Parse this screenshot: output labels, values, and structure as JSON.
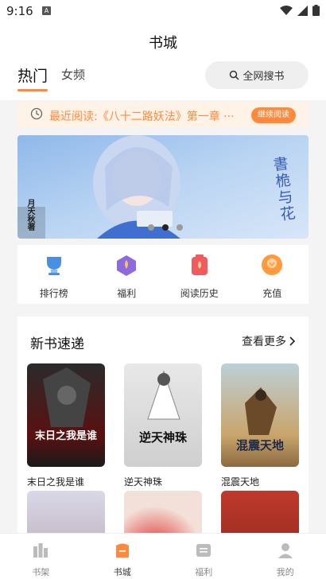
{
  "status_bar": {
    "time": "9:16",
    "notification_glyph": "A"
  },
  "header": {
    "title": "书城",
    "tabs": [
      {
        "label": "热门",
        "active": true
      },
      {
        "label": "女频",
        "active": false
      }
    ],
    "search_label": "全网搜书"
  },
  "recent_read": {
    "text": "最近阅读:《八十二路妖法》第一章 ···",
    "button_label": "继续阅读"
  },
  "banner": {
    "title_art": "書桅与花",
    "author_art": "月天秋著",
    "dot_count": 3,
    "active_dot": 1
  },
  "quick_menu": [
    {
      "label": "排行榜",
      "icon": "trophy-icon",
      "color": "#4a90e2"
    },
    {
      "label": "福利",
      "icon": "gift-icon",
      "color": "#8e6adf"
    },
    {
      "label": "阅读历史",
      "icon": "history-icon",
      "color": "#f05b5b"
    },
    {
      "label": "充值",
      "icon": "recharge-icon",
      "color": "#ff9a3d"
    }
  ],
  "new_books": {
    "title": "新书速递",
    "more_label": "查看更多",
    "books": [
      {
        "title": "末日之我是谁",
        "cover_text": "末日之我是谁"
      },
      {
        "title": "逆天神珠",
        "cover_text": "逆天神珠"
      },
      {
        "title": "混震天地",
        "cover_text": "混震天地"
      }
    ]
  },
  "tab_bar": [
    {
      "label": "书架",
      "icon": "bookshelf-icon",
      "active": false
    },
    {
      "label": "书城",
      "icon": "bookstore-icon",
      "active": true
    },
    {
      "label": "福利",
      "icon": "welfare-icon",
      "active": false
    },
    {
      "label": "我的",
      "icon": "profile-icon",
      "active": false
    }
  ],
  "colors": {
    "accent": "#ff8a3d",
    "accent_bg": "#fff3e8"
  }
}
